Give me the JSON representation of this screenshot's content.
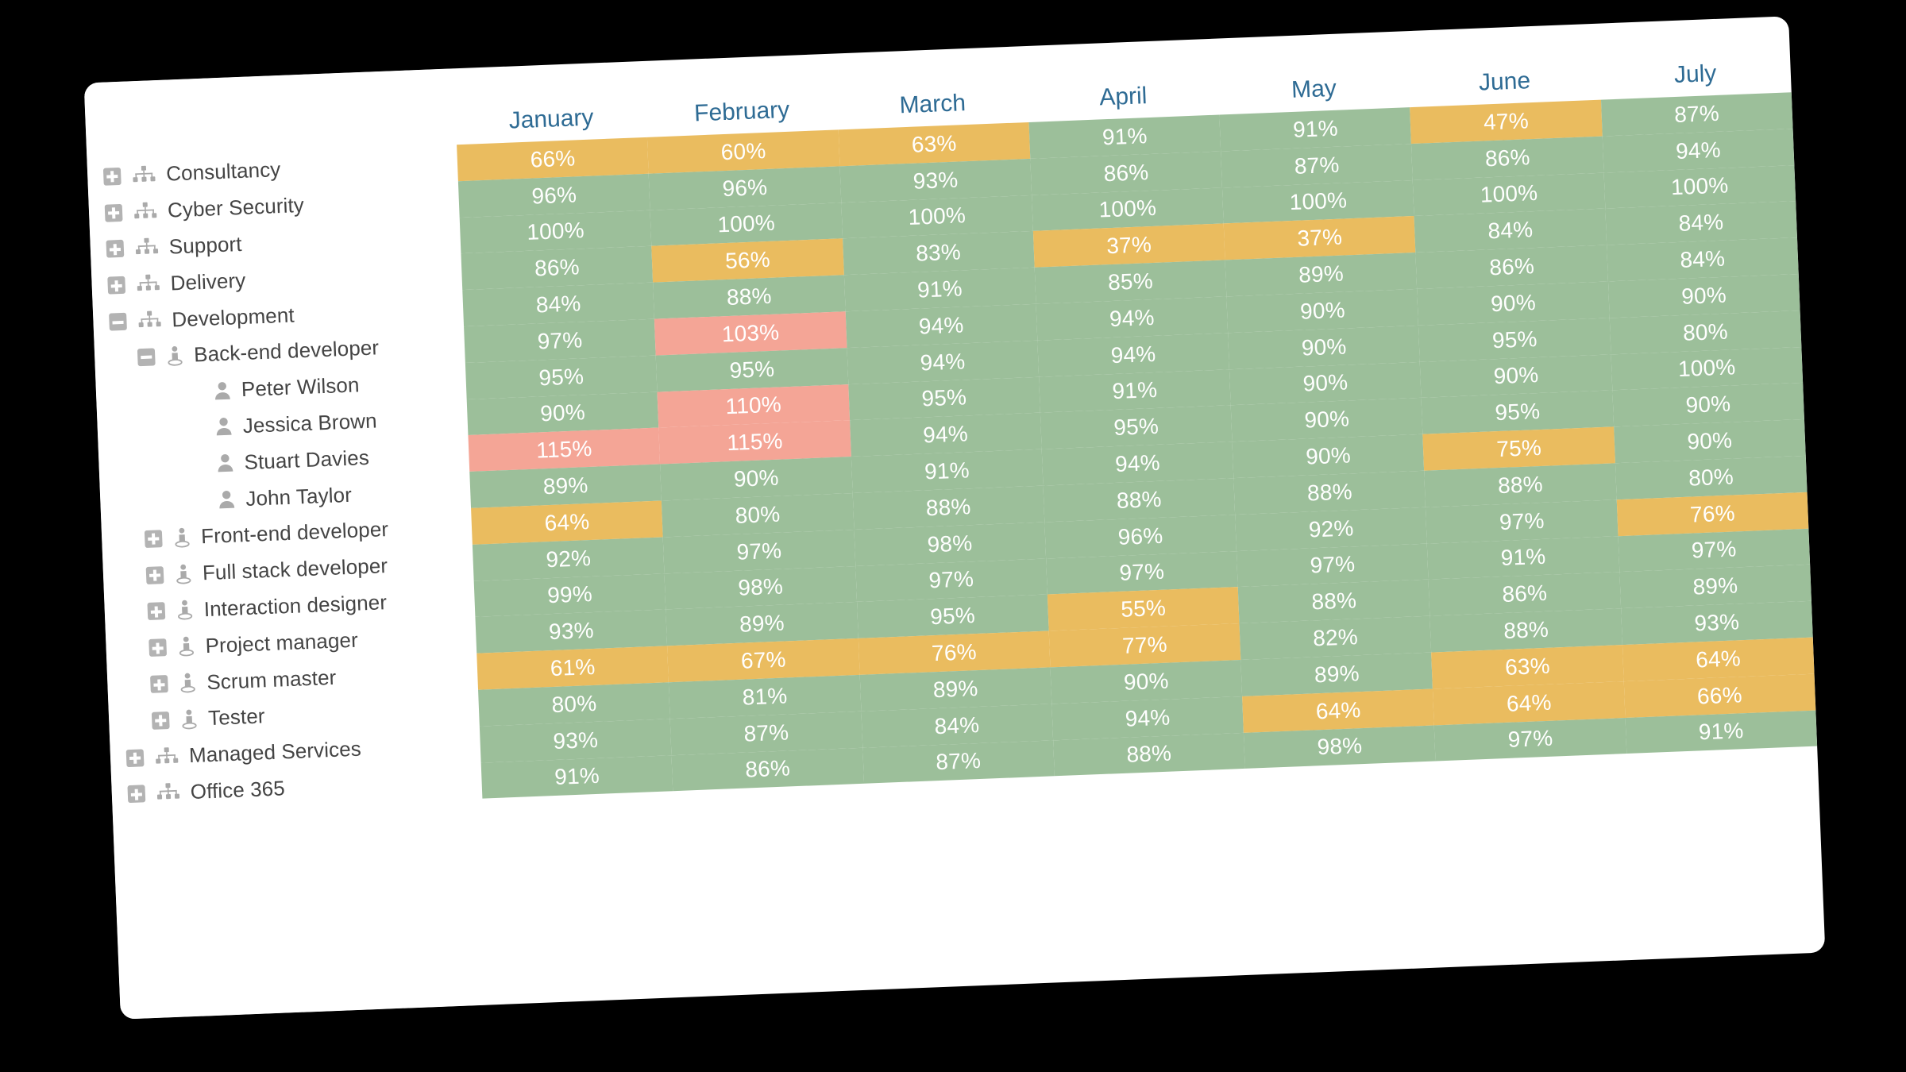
{
  "card": {
    "background_color": "#ffffff",
    "page_background_color": "#000000"
  },
  "legend_colors": {
    "green": "#9cbf9a",
    "amber": "#eabc5f",
    "red": "#f4a596",
    "header_text": "#2e6b94",
    "tree_text": "#444444",
    "icon_gray": "#aaaaaa"
  },
  "tree": {
    "items": [
      {
        "label": "Consultancy",
        "level": 0,
        "expander": "plus",
        "icon": "org-chart-icon"
      },
      {
        "label": "Cyber Security",
        "level": 0,
        "expander": "plus",
        "icon": "org-chart-icon"
      },
      {
        "label": "Support",
        "level": 0,
        "expander": "plus",
        "icon": "org-chart-icon"
      },
      {
        "label": "Delivery",
        "level": 0,
        "expander": "plus",
        "icon": "org-chart-icon"
      },
      {
        "label": "Development",
        "level": 0,
        "expander": "minus",
        "icon": "org-chart-icon"
      },
      {
        "label": "Back-end developer",
        "level": 1,
        "expander": "minus",
        "icon": "role-person-icon"
      },
      {
        "label": "Peter Wilson",
        "level": 2,
        "expander": "none",
        "icon": "person-icon"
      },
      {
        "label": "Jessica Brown",
        "level": 2,
        "expander": "none",
        "icon": "person-icon"
      },
      {
        "label": "Stuart Davies",
        "level": 2,
        "expander": "none",
        "icon": "person-icon"
      },
      {
        "label": "John Taylor",
        "level": 2,
        "expander": "none",
        "icon": "person-icon"
      },
      {
        "label": "Front-end developer",
        "level": 1,
        "expander": "plus",
        "icon": "role-person-icon"
      },
      {
        "label": "Full stack developer",
        "level": 1,
        "expander": "plus",
        "icon": "role-person-icon"
      },
      {
        "label": "Interaction designer",
        "level": 1,
        "expander": "plus",
        "icon": "role-person-icon"
      },
      {
        "label": "Project manager",
        "level": 1,
        "expander": "plus",
        "icon": "role-person-icon"
      },
      {
        "label": "Scrum master",
        "level": 1,
        "expander": "plus",
        "icon": "role-person-icon"
      },
      {
        "label": "Tester",
        "level": 1,
        "expander": "plus",
        "icon": "role-person-icon"
      },
      {
        "label": "Managed Services",
        "level": 0,
        "expander": "plus",
        "icon": "org-chart-icon"
      },
      {
        "label": "Office 365",
        "level": 0,
        "expander": "plus",
        "icon": "org-chart-icon"
      }
    ]
  },
  "chart_data": {
    "type": "heatmap",
    "title": "",
    "xlabel": "",
    "ylabel": "",
    "value_suffix": "%",
    "legend_position": "none",
    "grid": false,
    "categories": [
      "January",
      "February",
      "March",
      "April",
      "May",
      "June",
      "July"
    ],
    "rows": [
      "Consultancy",
      "Cyber Security",
      "Support",
      "Delivery",
      "Development",
      "Back-end developer",
      "Peter Wilson",
      "Jessica Brown",
      "Stuart Davies",
      "John Taylor",
      "Front-end developer",
      "Full stack developer",
      "Interaction designer",
      "Project manager",
      "Scrum master",
      "Tester",
      "Managed Services",
      "Office 365"
    ],
    "color_rules": {
      "amber": "value < 80",
      "green": "80 <= value <= 100",
      "red": "value > 100"
    },
    "series": [
      {
        "name": "Consultancy",
        "values": [
          66,
          60,
          63,
          91,
          91,
          47,
          87
        ]
      },
      {
        "name": "Cyber Security",
        "values": [
          96,
          96,
          93,
          86,
          87,
          86,
          94
        ]
      },
      {
        "name": "Support",
        "values": [
          100,
          100,
          100,
          100,
          100,
          100,
          100
        ]
      },
      {
        "name": "Delivery",
        "values": [
          86,
          56,
          83,
          37,
          37,
          84,
          84
        ]
      },
      {
        "name": "Development",
        "values": [
          84,
          88,
          91,
          85,
          89,
          86,
          84
        ]
      },
      {
        "name": "Back-end developer",
        "values": [
          97,
          103,
          94,
          94,
          90,
          90,
          90
        ]
      },
      {
        "name": "Peter Wilson",
        "values": [
          95,
          95,
          94,
          94,
          90,
          95,
          80
        ]
      },
      {
        "name": "Jessica Brown",
        "values": [
          90,
          110,
          95,
          91,
          90,
          90,
          100
        ]
      },
      {
        "name": "Stuart Davies",
        "values": [
          115,
          115,
          94,
          95,
          90,
          95,
          90
        ]
      },
      {
        "name": "John Taylor",
        "values": [
          89,
          90,
          91,
          94,
          90,
          75,
          90
        ]
      },
      {
        "name": "Front-end developer",
        "values": [
          64,
          80,
          88,
          88,
          88,
          88,
          80
        ]
      },
      {
        "name": "Full stack developer",
        "values": [
          92,
          97,
          98,
          96,
          92,
          97,
          76
        ]
      },
      {
        "name": "Interaction designer",
        "values": [
          99,
          98,
          97,
          97,
          97,
          91,
          97
        ]
      },
      {
        "name": "Project manager",
        "values": [
          93,
          89,
          95,
          55,
          88,
          86,
          89
        ]
      },
      {
        "name": "Scrum master",
        "values": [
          61,
          67,
          76,
          77,
          82,
          88,
          93
        ]
      },
      {
        "name": "Tester",
        "values": [
          80,
          81,
          89,
          90,
          89,
          63,
          64
        ]
      },
      {
        "name": "Managed Services",
        "values": [
          93,
          87,
          84,
          94,
          64,
          64,
          66
        ]
      },
      {
        "name": "Office 365",
        "values": [
          91,
          86,
          87,
          88,
          98,
          97,
          91
        ]
      }
    ]
  }
}
